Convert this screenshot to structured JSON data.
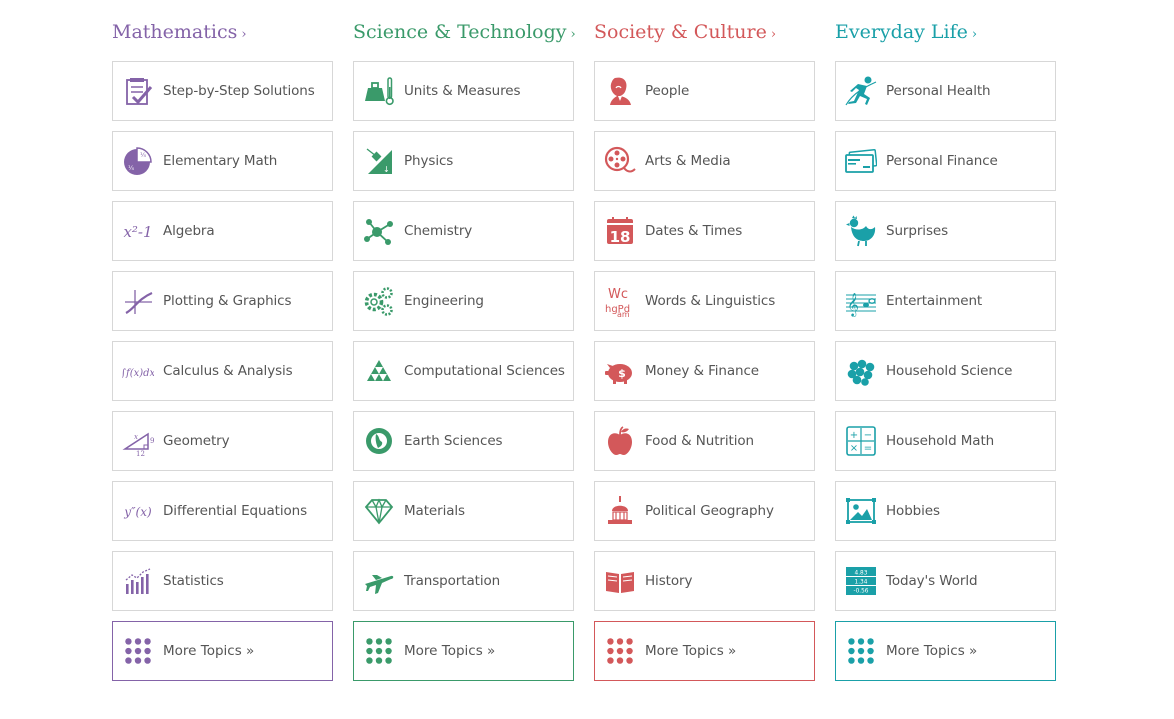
{
  "colors": {
    "math": "#8463a8",
    "science": "#3a9a6a",
    "society": "#d3585a",
    "everyday": "#1aa0a8"
  },
  "columns": [
    {
      "key": "math",
      "title": "Mathematics",
      "chevron": "›",
      "color": "#8463a8",
      "items": [
        {
          "label": "Step-by-Step Solutions",
          "icon": "checklist-icon"
        },
        {
          "label": "Elementary Math",
          "icon": "fraction-pie-icon"
        },
        {
          "label": "Algebra",
          "icon": "algebra-icon"
        },
        {
          "label": "Plotting & Graphics",
          "icon": "plot-icon"
        },
        {
          "label": "Calculus & Analysis",
          "icon": "integral-icon"
        },
        {
          "label": "Geometry",
          "icon": "triangle-icon"
        },
        {
          "label": "Differential Equations",
          "icon": "derivative-icon"
        },
        {
          "label": "Statistics",
          "icon": "stats-chart-icon"
        }
      ],
      "more": "More Topics »"
    },
    {
      "key": "science",
      "title": "Science & Technology",
      "chevron": "›",
      "color": "#3a9a6a",
      "items": [
        {
          "label": "Units & Measures",
          "icon": "weight-thermometer-icon"
        },
        {
          "label": "Physics",
          "icon": "physics-icon"
        },
        {
          "label": "Chemistry",
          "icon": "molecule-icon"
        },
        {
          "label": "Engineering",
          "icon": "gears-icon"
        },
        {
          "label": "Computational Sciences",
          "icon": "fractal-triangle-icon"
        },
        {
          "label": "Earth Sciences",
          "icon": "globe-icon"
        },
        {
          "label": "Materials",
          "icon": "diamond-icon"
        },
        {
          "label": "Transportation",
          "icon": "airplane-icon"
        }
      ],
      "more": "More Topics »"
    },
    {
      "key": "society",
      "title": "Society & Culture",
      "chevron": "›",
      "color": "#d3585a",
      "items": [
        {
          "label": "People",
          "icon": "person-bust-icon"
        },
        {
          "label": "Arts & Media",
          "icon": "film-reel-icon"
        },
        {
          "label": "Dates & Times",
          "icon": "calendar-icon",
          "icon_text": "18"
        },
        {
          "label": "Words & Linguistics",
          "icon": "letters-icon",
          "icon_text": "Wc hgPd am"
        },
        {
          "label": "Money & Finance",
          "icon": "piggy-bank-icon",
          "icon_text": "$"
        },
        {
          "label": "Food & Nutrition",
          "icon": "apple-icon"
        },
        {
          "label": "Political Geography",
          "icon": "capitol-icon"
        },
        {
          "label": "History",
          "icon": "book-icon"
        }
      ],
      "more": "More Topics »"
    },
    {
      "key": "everyday",
      "title": "Everyday Life",
      "chevron": "›",
      "color": "#1aa0a8",
      "items": [
        {
          "label": "Personal Health",
          "icon": "runner-icon"
        },
        {
          "label": "Personal Finance",
          "icon": "credit-card-icon"
        },
        {
          "label": "Surprises",
          "icon": "chicken-icon"
        },
        {
          "label": "Entertainment",
          "icon": "music-staff-icon"
        },
        {
          "label": "Household Science",
          "icon": "grapes-icon"
        },
        {
          "label": "Household Math",
          "icon": "calculator-icon"
        },
        {
          "label": "Hobbies",
          "icon": "picture-icon"
        },
        {
          "label": "Today's World",
          "icon": "ticker-icon",
          "icon_text": "4.83 1.34 -0.56"
        }
      ],
      "more": "More Topics »"
    }
  ]
}
